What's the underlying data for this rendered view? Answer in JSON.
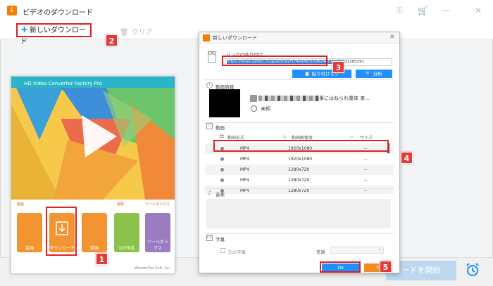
{
  "app": {
    "title": "ビデオのダウンロード"
  },
  "toolbar": {
    "new_download": "新しいダウンロード",
    "clear": "クリア"
  },
  "bottombar": {
    "start_download": "ードを開始"
  },
  "badges": [
    "1",
    "2",
    "3",
    "4",
    "5"
  ],
  "hd": {
    "title": "HD Video Converter Factory Pro",
    "section_video": "動画",
    "section_image": "画像",
    "section_toolbox": "ツールボックス",
    "tools": [
      {
        "label": "変換",
        "color": "#f29432"
      },
      {
        "label": "ダウンロード",
        "color": "#f29432"
      },
      {
        "label": "録画",
        "color": "#f29432"
      },
      {
        "label": "GIF作成",
        "color": "#8bc34a"
      },
      {
        "label": "ツールボックス",
        "color": "#9c7cc1"
      }
    ],
    "footer": "WonderFox Soft, Inc."
  },
  "dialog": {
    "title": "新しいダウンロード",
    "paste_link_label": "リンクの貼り付け",
    "url": "https://news.yahoo.co.jp/articles/524e6863169824eb122aac",
    "url_tail": "31285291",
    "paste_clear_button": "貼り付けとク",
    "analyze_button": "分析",
    "video_info_label": "動画情報",
    "video_title": "事にはねられ重体  来...",
    "duration": "未知",
    "video_label": "動画",
    "columns": {
      "format": "動画形式",
      "resolution": "動画解像度",
      "size": "サイズ"
    },
    "rows": [
      {
        "format": "MP4",
        "resolution": "1920x1080",
        "size": "--"
      },
      {
        "format": "MP4",
        "resolution": "1920x1080",
        "size": "--"
      },
      {
        "format": "MP4",
        "resolution": "1280x720",
        "size": "--"
      },
      {
        "format": "MP4",
        "resolution": "1280x720",
        "size": "--"
      },
      {
        "format": "MP4",
        "resolution": "1280x720",
        "size": "--"
      }
    ],
    "music_label": "音楽",
    "subtitle_label": "字幕",
    "original_subtitle": "元の字幕",
    "language_label": "言語",
    "ok_button": "Ok",
    "cancel_button": "キ"
  }
}
